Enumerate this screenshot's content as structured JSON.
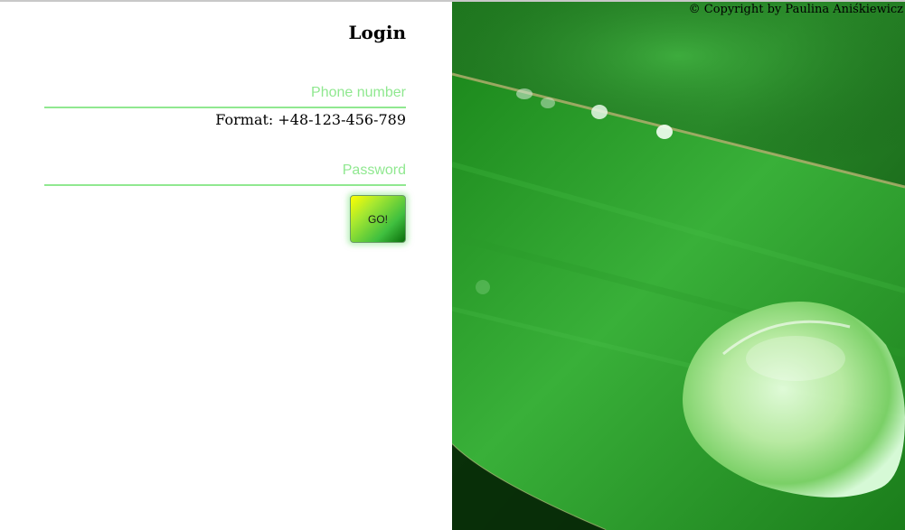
{
  "login": {
    "title": "Login",
    "phone_placeholder": "Phone number",
    "phone_hint": "Format: +48-123-456-789",
    "password_placeholder": "Password",
    "submit_label": "GO!"
  },
  "photo": {
    "copyright": "© Copyright by Paulina Aniśkiewicz",
    "subject": "green leaf with water droplet"
  },
  "colors": {
    "accent": "#90e890",
    "leaf": "#2f9e2f",
    "button_gradient": [
      "#ffff00",
      "#3fbf3f",
      "#0a6e0a"
    ]
  }
}
